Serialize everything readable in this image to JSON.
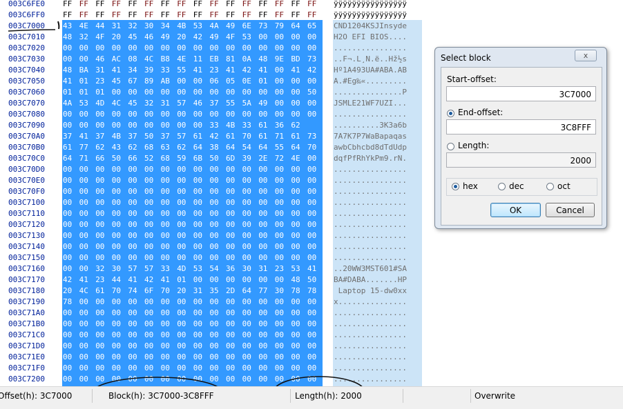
{
  "hex_view": {
    "rows": [
      {
        "offset": "003C6FE0",
        "bytes": [
          "FF",
          "FF",
          "FF",
          "FF",
          "FF",
          "FF",
          "FF",
          "FF",
          "FF",
          "FF",
          "FF",
          "FF",
          "FF",
          "FF",
          "FF",
          "FF"
        ],
        "ascii": "ÿÿÿÿÿÿÿÿÿÿÿÿÿÿÿÿ",
        "selected": false
      },
      {
        "offset": "003C6FF0",
        "bytes": [
          "FF",
          "FF",
          "FF",
          "FF",
          "FF",
          "FF",
          "FF",
          "FF",
          "FF",
          "FF",
          "FF",
          "FF",
          "FF",
          "FF",
          "FF",
          "FF"
        ],
        "ascii": "ÿÿÿÿÿÿÿÿÿÿÿÿÿÿÿÿ",
        "selected": false
      },
      {
        "offset": "003C7000",
        "bytes": [
          "43",
          "4E",
          "44",
          "31",
          "32",
          "30",
          "34",
          "4B",
          "53",
          "4A",
          "49",
          "6E",
          "73",
          "79",
          "64",
          "65"
        ],
        "ascii": "CND1204KSJInsyde",
        "selected": true
      },
      {
        "offset": "003C7010",
        "bytes": [
          "48",
          "32",
          "4F",
          "20",
          "45",
          "46",
          "49",
          "20",
          "42",
          "49",
          "4F",
          "53",
          "00",
          "00",
          "00",
          "00"
        ],
        "ascii": "H2O EFI BIOS....",
        "selected": true
      },
      {
        "offset": "003C7020",
        "bytes": [
          "00",
          "00",
          "00",
          "00",
          "00",
          "00",
          "00",
          "00",
          "00",
          "00",
          "00",
          "00",
          "00",
          "00",
          "00",
          "00"
        ],
        "ascii": "................",
        "selected": true
      },
      {
        "offset": "003C7030",
        "bytes": [
          "00",
          "00",
          "46",
          "AC",
          "08",
          "4C",
          "B8",
          "4E",
          "11",
          "EB",
          "81",
          "0A",
          "48",
          "9E",
          "BD",
          "73"
        ],
        "ascii": "..F¬.L¸N.ë..Hž½s",
        "selected": true
      },
      {
        "offset": "003C7040",
        "bytes": [
          "48",
          "BA",
          "31",
          "41",
          "34",
          "39",
          "33",
          "55",
          "41",
          "23",
          "41",
          "42",
          "41",
          "00",
          "41",
          "42"
        ],
        "ascii": "Hº1A493UA#ABA.AB",
        "selected": true
      },
      {
        "offset": "003C7050",
        "bytes": [
          "41",
          "01",
          "23",
          "45",
          "67",
          "89",
          "AB",
          "00",
          "00",
          "06",
          "05",
          "0E",
          "01",
          "00",
          "00",
          "00"
        ],
        "ascii": "A.#Eg‰«.........",
        "selected": true
      },
      {
        "offset": "003C7060",
        "bytes": [
          "01",
          "01",
          "01",
          "00",
          "00",
          "00",
          "00",
          "00",
          "00",
          "00",
          "00",
          "00",
          "00",
          "00",
          "00",
          "50"
        ],
        "ascii": "...............P",
        "selected": true
      },
      {
        "offset": "003C7070",
        "bytes": [
          "4A",
          "53",
          "4D",
          "4C",
          "45",
          "32",
          "31",
          "57",
          "46",
          "37",
          "55",
          "5A",
          "49",
          "00",
          "00",
          "00"
        ],
        "ascii": "JSMLE21WF7UZI...",
        "selected": true
      },
      {
        "offset": "003C7080",
        "bytes": [
          "00",
          "00",
          "00",
          "00",
          "00",
          "00",
          "00",
          "00",
          "00",
          "00",
          "00",
          "00",
          "00",
          "00",
          "00",
          "00"
        ],
        "ascii": "................",
        "selected": true
      },
      {
        "offset": "003C7090",
        "bytes": [
          "00",
          "00",
          "00",
          "00",
          "00",
          "00",
          "00",
          "00",
          "00",
          "33",
          "4B",
          "33",
          "61",
          "36",
          "62"
        ],
        "ascii": "..........3K3a6b",
        "selected": true
      },
      {
        "offset": "003C70A0",
        "bytes": [
          "37",
          "41",
          "37",
          "4B",
          "37",
          "50",
          "37",
          "57",
          "61",
          "42",
          "61",
          "70",
          "61",
          "71",
          "61",
          "73"
        ],
        "ascii": "7A7K7P7WaBapaqas",
        "selected": true
      },
      {
        "offset": "003C70B0",
        "bytes": [
          "61",
          "77",
          "62",
          "43",
          "62",
          "68",
          "63",
          "62",
          "64",
          "38",
          "64",
          "54",
          "64",
          "55",
          "64",
          "70"
        ],
        "ascii": "awbCbhcbd8dTdUdp",
        "selected": true
      },
      {
        "offset": "003C70C0",
        "bytes": [
          "64",
          "71",
          "66",
          "50",
          "66",
          "52",
          "68",
          "59",
          "6B",
          "50",
          "6D",
          "39",
          "2E",
          "72",
          "4E",
          "00"
        ],
        "ascii": "dqfPfRhYkPm9.rN.",
        "selected": true
      },
      {
        "offset": "003C70D0",
        "bytes": [
          "00",
          "00",
          "00",
          "00",
          "00",
          "00",
          "00",
          "00",
          "00",
          "00",
          "00",
          "00",
          "00",
          "00",
          "00",
          "00"
        ],
        "ascii": "................",
        "selected": true
      },
      {
        "offset": "003C70E0",
        "bytes": [
          "00",
          "00",
          "00",
          "00",
          "00",
          "00",
          "00",
          "00",
          "00",
          "00",
          "00",
          "00",
          "00",
          "00",
          "00",
          "00"
        ],
        "ascii": "................",
        "selected": true
      },
      {
        "offset": "003C70F0",
        "bytes": [
          "00",
          "00",
          "00",
          "00",
          "00",
          "00",
          "00",
          "00",
          "00",
          "00",
          "00",
          "00",
          "00",
          "00",
          "00",
          "00"
        ],
        "ascii": "................",
        "selected": true
      },
      {
        "offset": "003C7100",
        "bytes": [
          "00",
          "00",
          "00",
          "00",
          "00",
          "00",
          "00",
          "00",
          "00",
          "00",
          "00",
          "00",
          "00",
          "00",
          "00",
          "00"
        ],
        "ascii": "................",
        "selected": true
      },
      {
        "offset": "003C7110",
        "bytes": [
          "00",
          "00",
          "00",
          "00",
          "00",
          "00",
          "00",
          "00",
          "00",
          "00",
          "00",
          "00",
          "00",
          "00",
          "00",
          "00"
        ],
        "ascii": "................",
        "selected": true
      },
      {
        "offset": "003C7120",
        "bytes": [
          "00",
          "00",
          "00",
          "00",
          "00",
          "00",
          "00",
          "00",
          "00",
          "00",
          "00",
          "00",
          "00",
          "00",
          "00",
          "00"
        ],
        "ascii": "................",
        "selected": true
      },
      {
        "offset": "003C7130",
        "bytes": [
          "00",
          "00",
          "00",
          "00",
          "00",
          "00",
          "00",
          "00",
          "00",
          "00",
          "00",
          "00",
          "00",
          "00",
          "00",
          "00"
        ],
        "ascii": "................",
        "selected": true
      },
      {
        "offset": "003C7140",
        "bytes": [
          "00",
          "00",
          "00",
          "00",
          "00",
          "00",
          "00",
          "00",
          "00",
          "00",
          "00",
          "00",
          "00",
          "00",
          "00",
          "00"
        ],
        "ascii": "................",
        "selected": true
      },
      {
        "offset": "003C7150",
        "bytes": [
          "00",
          "00",
          "00",
          "00",
          "00",
          "00",
          "00",
          "00",
          "00",
          "00",
          "00",
          "00",
          "00",
          "00",
          "00",
          "00"
        ],
        "ascii": "................",
        "selected": true
      },
      {
        "offset": "003C7160",
        "bytes": [
          "00",
          "00",
          "32",
          "30",
          "57",
          "57",
          "33",
          "4D",
          "53",
          "54",
          "36",
          "30",
          "31",
          "23",
          "53",
          "41"
        ],
        "ascii": "..20WW3MST601#SA",
        "selected": true
      },
      {
        "offset": "003C7170",
        "bytes": [
          "42",
          "41",
          "23",
          "44",
          "41",
          "42",
          "41",
          "01",
          "00",
          "00",
          "00",
          "00",
          "00",
          "00",
          "48",
          "50"
        ],
        "ascii": "BA#DABA.......HP",
        "selected": true
      },
      {
        "offset": "003C7180",
        "bytes": [
          "20",
          "4C",
          "61",
          "70",
          "74",
          "6F",
          "70",
          "20",
          "31",
          "35",
          "2D",
          "64",
          "77",
          "30",
          "78",
          "78"
        ],
        "ascii": " Laptop 15-dw0xx",
        "selected": true
      },
      {
        "offset": "003C7190",
        "bytes": [
          "78",
          "00",
          "00",
          "00",
          "00",
          "00",
          "00",
          "00",
          "00",
          "00",
          "00",
          "00",
          "00",
          "00",
          "00",
          "00"
        ],
        "ascii": "x...............",
        "selected": true
      },
      {
        "offset": "003C71A0",
        "bytes": [
          "00",
          "00",
          "00",
          "00",
          "00",
          "00",
          "00",
          "00",
          "00",
          "00",
          "00",
          "00",
          "00",
          "00",
          "00",
          "00"
        ],
        "ascii": "................",
        "selected": true
      },
      {
        "offset": "003C71B0",
        "bytes": [
          "00",
          "00",
          "00",
          "00",
          "00",
          "00",
          "00",
          "00",
          "00",
          "00",
          "00",
          "00",
          "00",
          "00",
          "00",
          "00"
        ],
        "ascii": "................",
        "selected": true
      },
      {
        "offset": "003C71C0",
        "bytes": [
          "00",
          "00",
          "00",
          "00",
          "00",
          "00",
          "00",
          "00",
          "00",
          "00",
          "00",
          "00",
          "00",
          "00",
          "00",
          "00"
        ],
        "ascii": "................",
        "selected": true
      },
      {
        "offset": "003C71D0",
        "bytes": [
          "00",
          "00",
          "00",
          "00",
          "00",
          "00",
          "00",
          "00",
          "00",
          "00",
          "00",
          "00",
          "00",
          "00",
          "00",
          "00"
        ],
        "ascii": "................",
        "selected": true
      },
      {
        "offset": "003C71E0",
        "bytes": [
          "00",
          "00",
          "00",
          "00",
          "00",
          "00",
          "00",
          "00",
          "00",
          "00",
          "00",
          "00",
          "00",
          "00",
          "00",
          "00"
        ],
        "ascii": "................",
        "selected": true
      },
      {
        "offset": "003C71F0",
        "bytes": [
          "00",
          "00",
          "00",
          "00",
          "00",
          "00",
          "00",
          "00",
          "00",
          "00",
          "00",
          "00",
          "00",
          "00",
          "00",
          "00"
        ],
        "ascii": "................",
        "selected": true
      },
      {
        "offset": "003C7200",
        "bytes": [
          "00",
          "00",
          "00",
          "00",
          "00",
          "00",
          "00",
          "00",
          "00",
          "00",
          "00",
          "00",
          "00",
          "00",
          "00",
          "00"
        ],
        "ascii": "................",
        "selected": true
      }
    ]
  },
  "dialog": {
    "title": "Select block",
    "close_glyph": "x",
    "start_offset_label": "Start-offset:",
    "start_offset_value": "3C7000",
    "end_offset_label": "End-offset:",
    "end_offset_value": "3C8FFF",
    "end_offset_selected": true,
    "length_label": "Length:",
    "length_value": "2000",
    "length_selected": false,
    "radix_options": [
      "hex",
      "dec",
      "oct"
    ],
    "radix_selected": "hex",
    "ok_label": "OK",
    "cancel_label": "Cancel"
  },
  "status_bar": {
    "offset_text": "Offset(h): 3C7000",
    "block_text": "Block(h): 3C7000-3C8FFF",
    "length_text": "Length(h): 2000",
    "mode_text": "Overwrite"
  },
  "colors": {
    "selection_hex": "#3399ff",
    "selection_ascii": "#cce4f7",
    "offset_text": "#00209a"
  }
}
